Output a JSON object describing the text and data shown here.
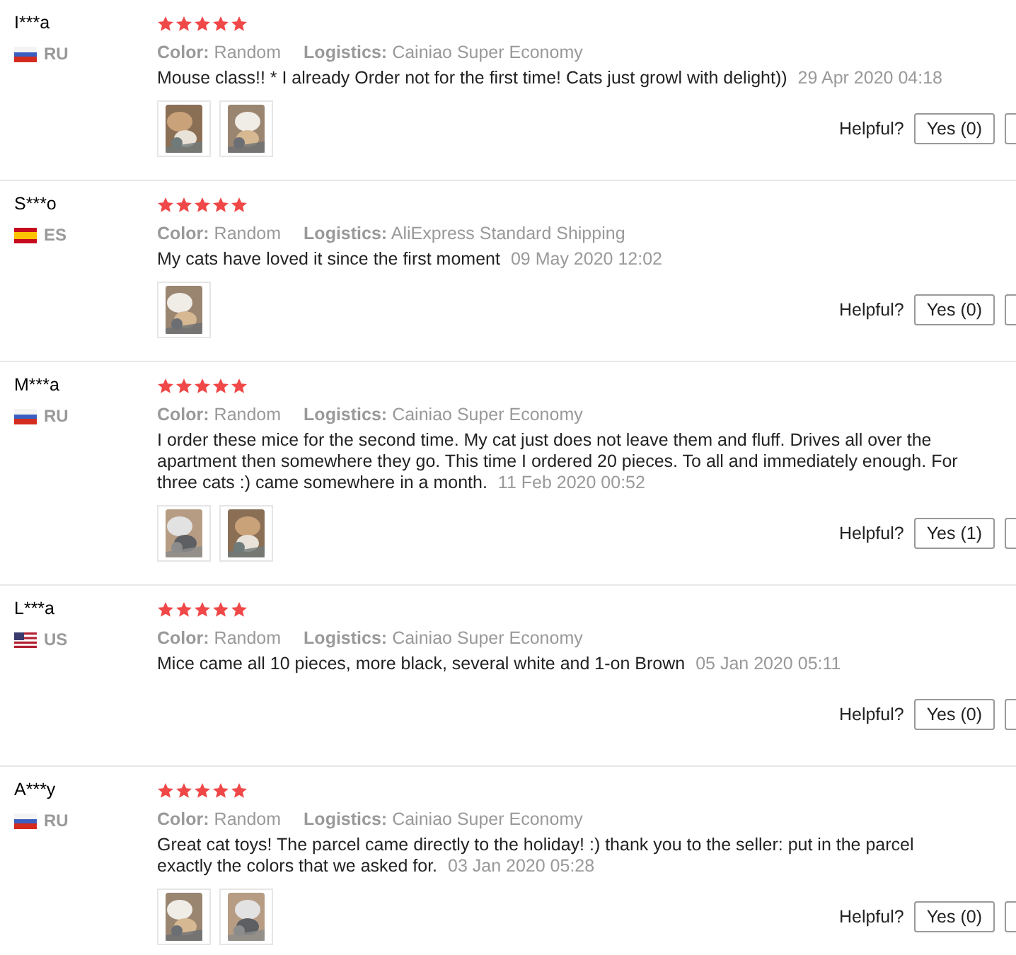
{
  "reviews": [
    {
      "user": "I***a",
      "flag": {
        "kind": "russia"
      },
      "country": "RU",
      "stars": 5,
      "color_label": "Color:",
      "color_value": "Random",
      "logistics_label": "Logistics:",
      "logistics_value": "Cainiao Super Economy",
      "text": "Mouse class!! * I already Order not for the first time! Cats just growl with delight))",
      "date": "29 Apr 2020 04:18",
      "photos": [
        {
          "kind": "picture"
        },
        {
          "kind": "picture"
        }
      ],
      "helpful_label": "Helpful?",
      "yes_button": "Yes (0)"
    },
    {
      "user": "S***o",
      "flag": {
        "kind": "spain"
      },
      "country": "ES",
      "stars": 5,
      "color_label": "Color:",
      "color_value": "Random",
      "logistics_label": "Logistics:",
      "logistics_value": "AliExpress Standard Shipping",
      "text": "My cats have loved it since the first moment",
      "date": "09 May 2020 12:02",
      "photos": [
        {
          "kind": "picture"
        }
      ],
      "helpful_label": "Helpful?",
      "yes_button": "Yes (0)"
    },
    {
      "user": "M***a",
      "flag": {
        "kind": "russia"
      },
      "country": "RU",
      "stars": 5,
      "color_label": "Color:",
      "color_value": "Random",
      "logistics_label": "Logistics:",
      "logistics_value": "Cainiao Super Economy",
      "text": "I order these mice for the second time. My cat just does not leave them and fluff. Drives all over the apartment then somewhere they go. This time I ordered 20 pieces. To all and immediately enough. For three cats :) came somewhere in a month.",
      "date": "11 Feb 2020 00:52",
      "photos": [
        {
          "kind": "picture"
        },
        {
          "kind": "picture"
        }
      ],
      "helpful_label": "Helpful?",
      "yes_button": "Yes (1)"
    },
    {
      "user": "L***a",
      "flag": {
        "kind": "usa"
      },
      "country": "US",
      "stars": 5,
      "color_label": "Color:",
      "color_value": "Random",
      "logistics_label": "Logistics:",
      "logistics_value": "Cainiao Super Economy",
      "text": "Mice came all 10 pieces, more black, several white and 1-on Brown",
      "date": "05 Jan 2020 05:11",
      "helpful_label": "Helpful?",
      "yes_button": "Yes (0)"
    },
    {
      "user": "A***y",
      "flag": {
        "kind": "russia"
      },
      "country": "RU",
      "stars": 5,
      "color_label": "Color:",
      "color_value": "Random",
      "logistics_label": "Logistics:",
      "logistics_value": "Cainiao Super Economy",
      "text": "Great cat toys! The parcel came directly to the holiday! :) thank you to the seller: put in the parcel exactly the colors that we asked for.",
      "date": "03 Jan 2020 05:28",
      "photos": [
        {
          "kind": "picture"
        },
        {
          "kind": "picture"
        }
      ],
      "helpful_label": "Helpful?",
      "yes_button": "Yes (0)"
    }
  ]
}
